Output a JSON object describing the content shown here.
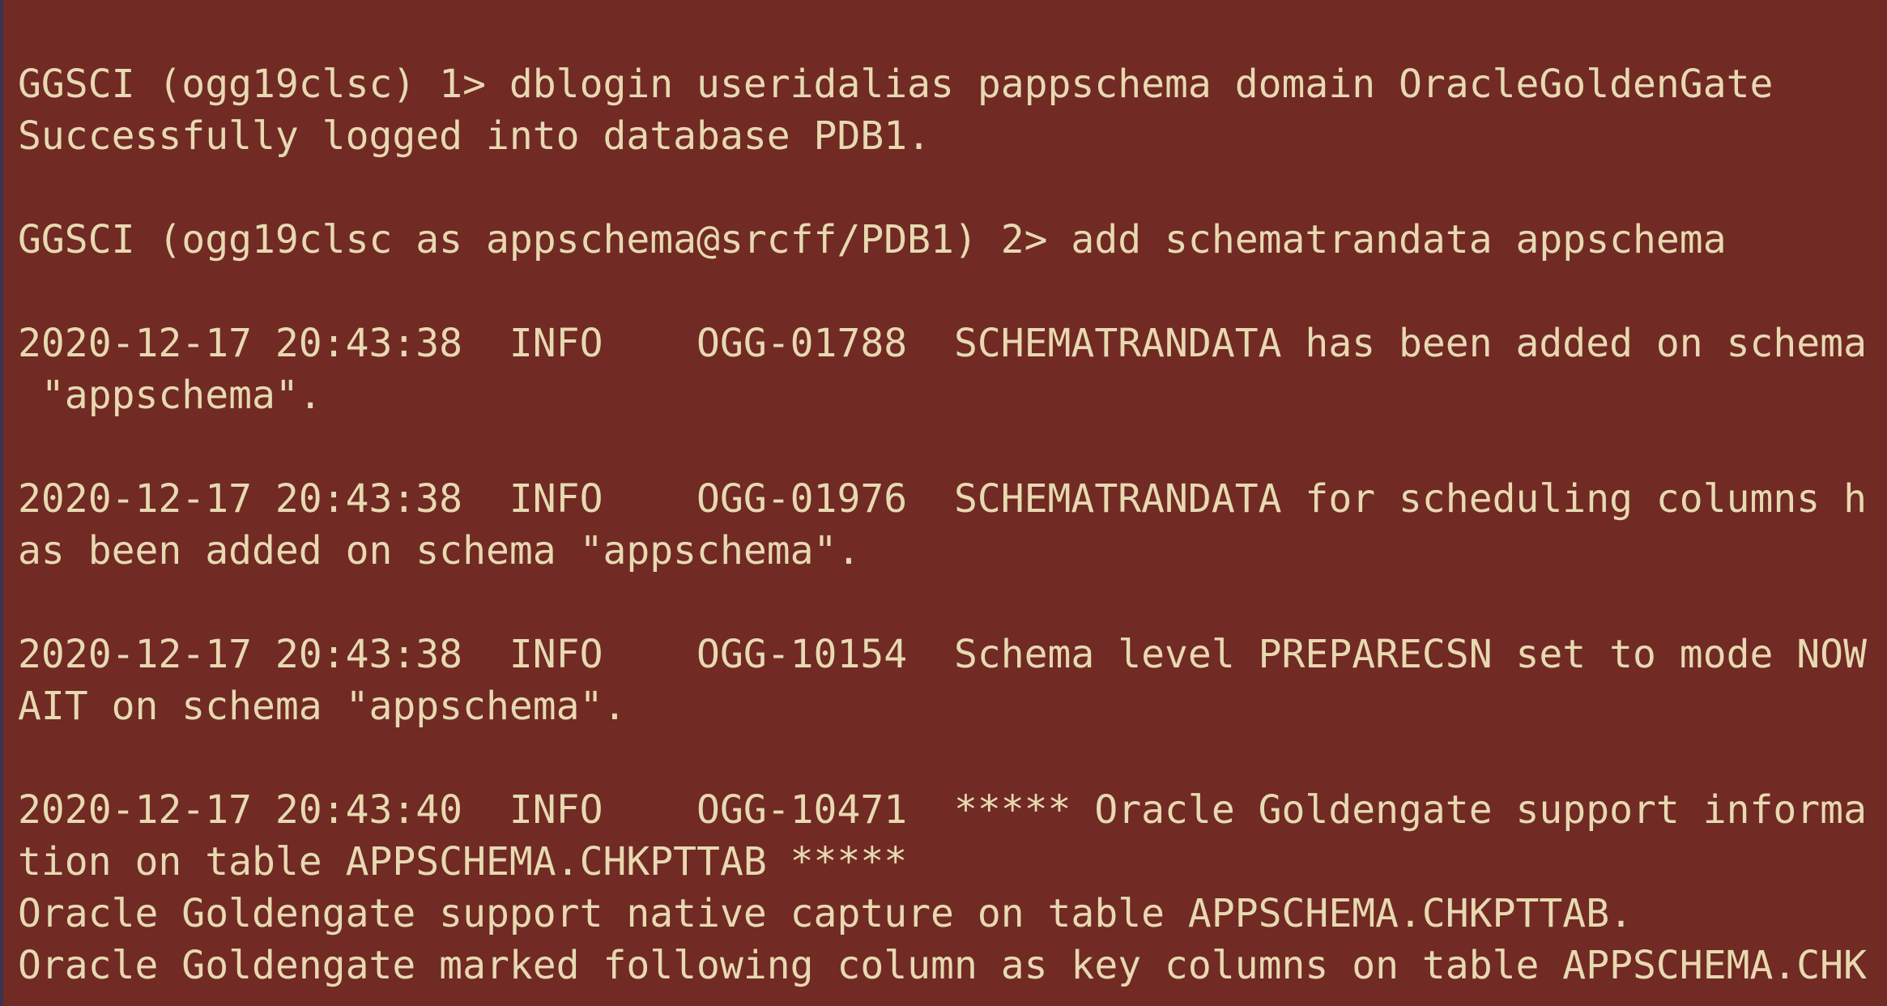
{
  "terminal": {
    "lines": [
      "GGSCI (ogg19clsc) 1> dblogin useridalias pappschema domain OracleGoldenGate",
      "Successfully logged into database PDB1.",
      "",
      "GGSCI (ogg19clsc as appschema@srcff/PDB1) 2> add schematrandata appschema",
      "",
      "2020-12-17 20:43:38  INFO    OGG-01788  SCHEMATRANDATA has been added on schema",
      " \"appschema\".",
      "",
      "2020-12-17 20:43:38  INFO    OGG-01976  SCHEMATRANDATA for scheduling columns h",
      "as been added on schema \"appschema\".",
      "",
      "2020-12-17 20:43:38  INFO    OGG-10154  Schema level PREPARECSN set to mode NOW",
      "AIT on schema \"appschema\".",
      "",
      "2020-12-17 20:43:40  INFO    OGG-10471  ***** Oracle Goldengate support informa",
      "tion on table APPSCHEMA.CHKPTTAB *****",
      "Oracle Goldengate support native capture on table APPSCHEMA.CHKPTTAB.",
      "Oracle Goldengate marked following column as key columns on table APPSCHEMA.CHK"
    ]
  },
  "colors": {
    "background": "#712a24",
    "text": "#e7d9b1",
    "left_border": "#3b3350"
  }
}
